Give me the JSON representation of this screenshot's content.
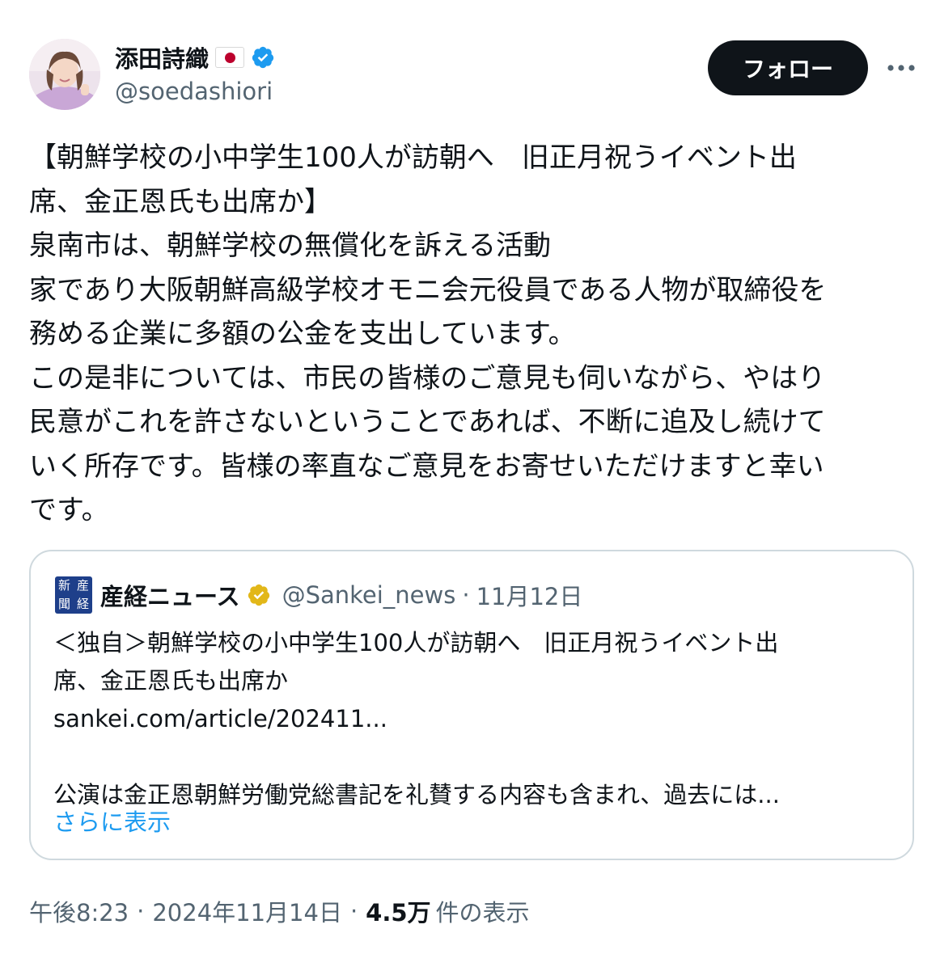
{
  "author": {
    "display_name": "添田詩織",
    "handle": "@soedashiori"
  },
  "actions": {
    "follow_label": "フォロー"
  },
  "post": {
    "text": "【朝鮮学校の小中学生100人が訪朝へ　旧正月祝うイベント出\n席、金正恩氏も出席か】\n泉南市は、朝鮮学校の無償化を訴える活動\n家であり大阪朝鮮高級学校オモニ会元役員である人物が取締役を\n務める企業に多額の公金を支出しています。\nこの是非については、市民の皆様のご意見も伺いながら、やはり\n民意がこれを許さないということであれば、不断に追及し続けて\nいく所存です。皆様の率直なご意見をお寄せいただけますと幸い\nです。"
  },
  "quote": {
    "logo_chars": [
      "新",
      "産",
      "聞",
      "経"
    ],
    "name": "産経ニュース",
    "handle": "@Sankei_news",
    "separator": "·",
    "date": "11月12日",
    "text": "＜独自＞朝鮮学校の小中学生100人が訪朝へ　旧正月祝うイベント出\n席、金正恩氏も出席か\nsankei.com/article/202411...\n\n公演は金正恩朝鮮労働党総書記を礼賛する内容も含まれ、過去には...",
    "show_more": "さらに表示"
  },
  "meta": {
    "time": "午後8:23",
    "separator": "·",
    "date": "2024年11月14日",
    "views_count": "4.5万",
    "views_label": "件の表示"
  },
  "colors": {
    "text": "#0f1419",
    "secondary": "#536471",
    "link": "#1d9bf0",
    "verified_blue": "#1d9bf0",
    "verified_gold": "#e2b719",
    "flag_red": "#bc002d"
  },
  "icons": {
    "avatar": "avatar",
    "flag": "japan-flag-icon",
    "verified": "verified-badge-icon",
    "more": "more-horizontal-icon",
    "quote_logo": "sankei-logo-icon",
    "gold_verified": "gold-verified-badge-icon"
  }
}
